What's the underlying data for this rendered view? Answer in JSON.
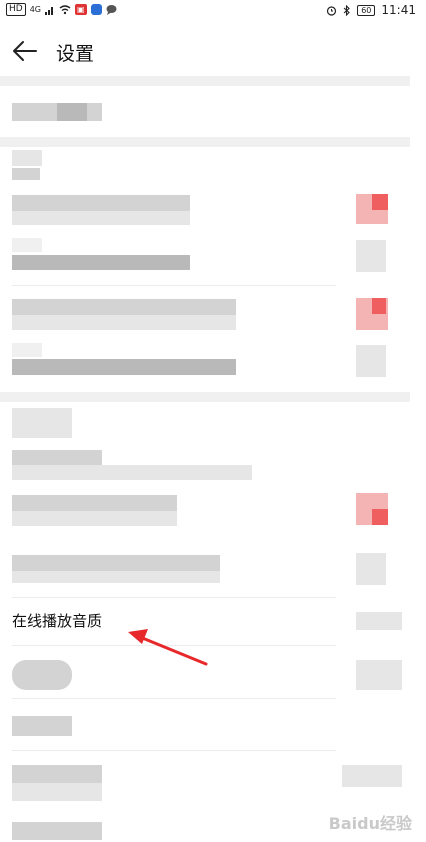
{
  "status_bar": {
    "hd_label": "HD",
    "network_label": "4G",
    "time": "11:41",
    "battery": "60"
  },
  "header": {
    "title": "设置"
  },
  "settings": {
    "visible_item_label": "在线播放音质"
  },
  "watermark": {
    "text": "Baidu经验"
  },
  "colors": {
    "accent_red": "#e8403a",
    "annotation_arrow": "#e8292b"
  }
}
